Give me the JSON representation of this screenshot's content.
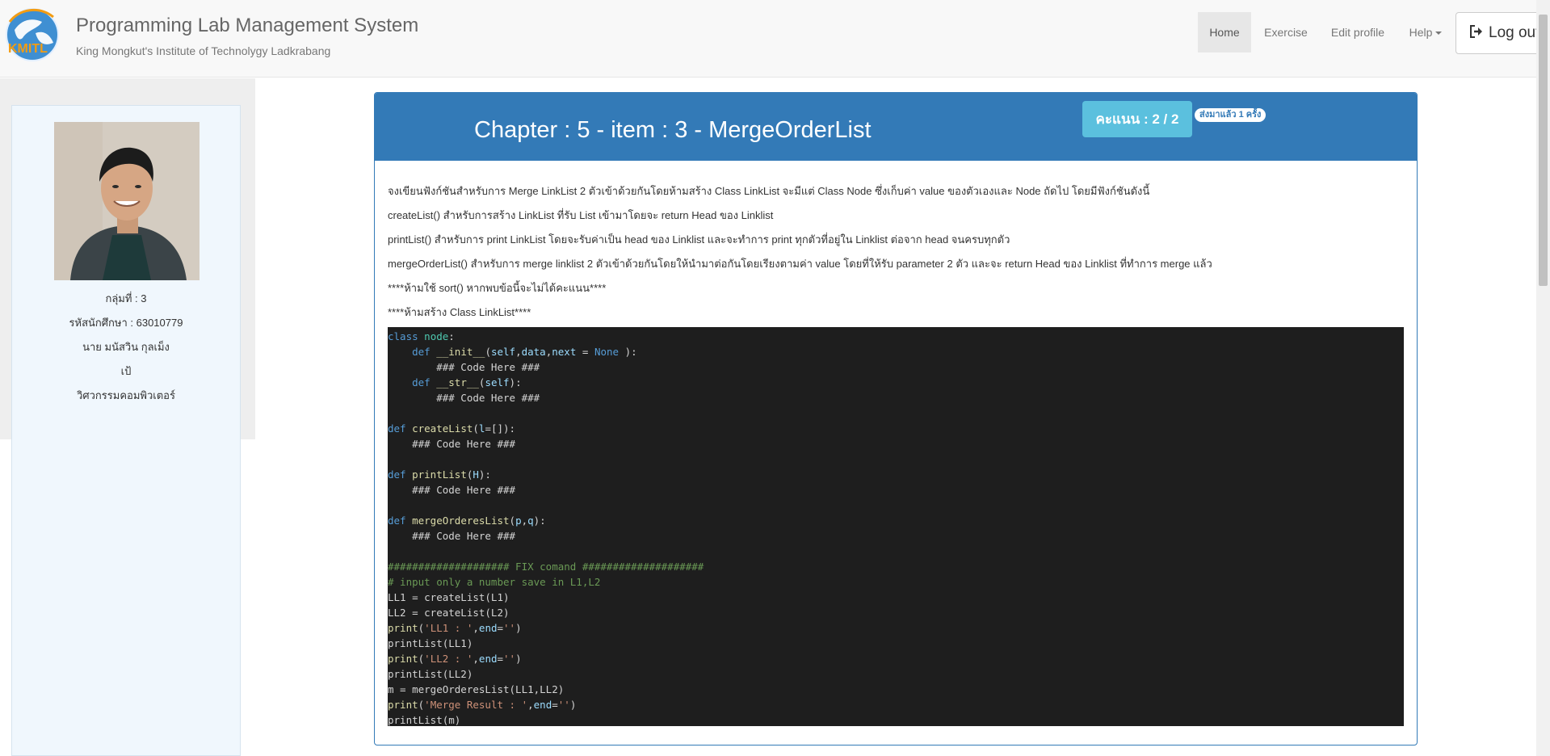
{
  "header": {
    "title": "Programming Lab Management System",
    "subtitle": "King Mongkut's Institute of Technolygy Ladkrabang",
    "logo_text": "KMITL"
  },
  "nav": {
    "home": "Home",
    "exercise": "Exercise",
    "edit_profile": "Edit profile",
    "help": "Help",
    "logout": "Log out"
  },
  "profile": {
    "group": "กลุ่มที่ : 3",
    "student_id": "รหัสนักศึกษา : 63010779",
    "name": "นาย มนัสวิน กุลเม็ง",
    "nickname": "เป้",
    "department": "วิศวกรรมคอมพิวเตอร์"
  },
  "exercise": {
    "title": "Chapter : 5 - item : 3 - MergeOrderList",
    "score": "คะแนน : 2 / 2",
    "sent_badge": "ส่งมาแล้ว 1 ครั้ง",
    "description": [
      "จงเขียนฟังก์ชันสำหรับการ Merge LinkList 2 ตัวเข้าด้วยกันโดยห้ามสร้าง Class LinkList จะมีแต่ Class Node ซึ่งเก็บค่า value ของตัวเองและ Node ถัดไป โดยมีฟังก์ชันดังนี้",
      "createList() สำหรับการสร้าง LinkList ที่รับ List เข้ามาโดยจะ return Head ของ Linklist",
      "printList() สำหรับการ print LinkList โดยจะรับค่าเป็น head ของ Linklist และจะทำการ print ทุกตัวที่อยู่ใน Linklist ต่อจาก head จนครบทุกตัว",
      "mergeOrderList() สำหรับการ merge linklist 2 ตัวเข้าด้วยกันโดยให้นำมาต่อกันโดยเรียงตามค่า value โดยที่ให้รับ parameter 2 ตัว และจะ return Head ของ Linklist ที่ทำการ merge แล้ว",
      "****ห้ามใช้ sort() หากพบข้อนี้จะไม่ได้คะแนน****",
      "****ห้ามสร้าง Class LinkList****"
    ]
  },
  "code": {
    "class_line": {
      "kw": "class",
      "name": "node",
      "colon": ":"
    },
    "init_line": {
      "indent": "    ",
      "kw": "def",
      "name": "__init__",
      "open": "(",
      "p1": "self",
      "c1": ",",
      "p2": "data",
      "c2": ",",
      "p3": "next",
      "eq": " = ",
      "none": "None",
      "close": " ):"
    },
    "comment_1": "        ### Code Here ###",
    "str_line": {
      "indent": "    ",
      "kw": "def",
      "name": "__str__",
      "open": "(",
      "p1": "self",
      "close": "):"
    },
    "comment_2": "        ### Code Here ###",
    "create_line": {
      "kw": "def",
      "name": "createList",
      "open": "(",
      "p1": "l",
      "rest": "=[]):"
    },
    "comment_3": "    ### Code Here ###",
    "print_def_line": {
      "kw": "def",
      "name": "printList",
      "open": "(",
      "p1": "H",
      "close": "):"
    },
    "comment_4": "    ### Code Here ###",
    "merge_def_line": {
      "kw": "def",
      "name": "mergeOrderesList",
      "open": "(",
      "p1": "p",
      "c1": ",",
      "p2": "q",
      "close": "):"
    },
    "comment_5": "    ### Code Here ###",
    "fix_comment": "#################### FIX comand ####################",
    "input_comment": "# input only a number save in L1,L2",
    "ll1": "LL1 = createList(L1)",
    "ll2": "LL2 = createList(L2)",
    "print1": {
      "fn": "print",
      "open": "(",
      "s": "'LL1 : '",
      "c": ",",
      "p": "end",
      "eq": "=",
      "s2": "''",
      "close": ")"
    },
    "printlist1": "printList(LL1)",
    "print2": {
      "fn": "print",
      "open": "(",
      "s": "'LL2 : '",
      "c": ",",
      "p": "end",
      "eq": "=",
      "s2": "''",
      "close": ")"
    },
    "printlist2": "printList(LL2)",
    "merge_call": "m = mergeOrderesList(LL1,LL2)",
    "print3": {
      "fn": "print",
      "open": "(",
      "s": "'Merge Result : '",
      "c": ",",
      "p": "end",
      "eq": "=",
      "s2": "''",
      "close": ")"
    },
    "printlist3": "printList(m)"
  },
  "colors": {
    "primary": "#337ab7",
    "info": "#5bc0de",
    "code_bg": "#1e1e1e",
    "profile_bg": "#f0f7fd"
  },
  "icons": [
    "kmitl-logo",
    "logout-icon",
    "caret-down-icon",
    "user-avatar"
  ]
}
